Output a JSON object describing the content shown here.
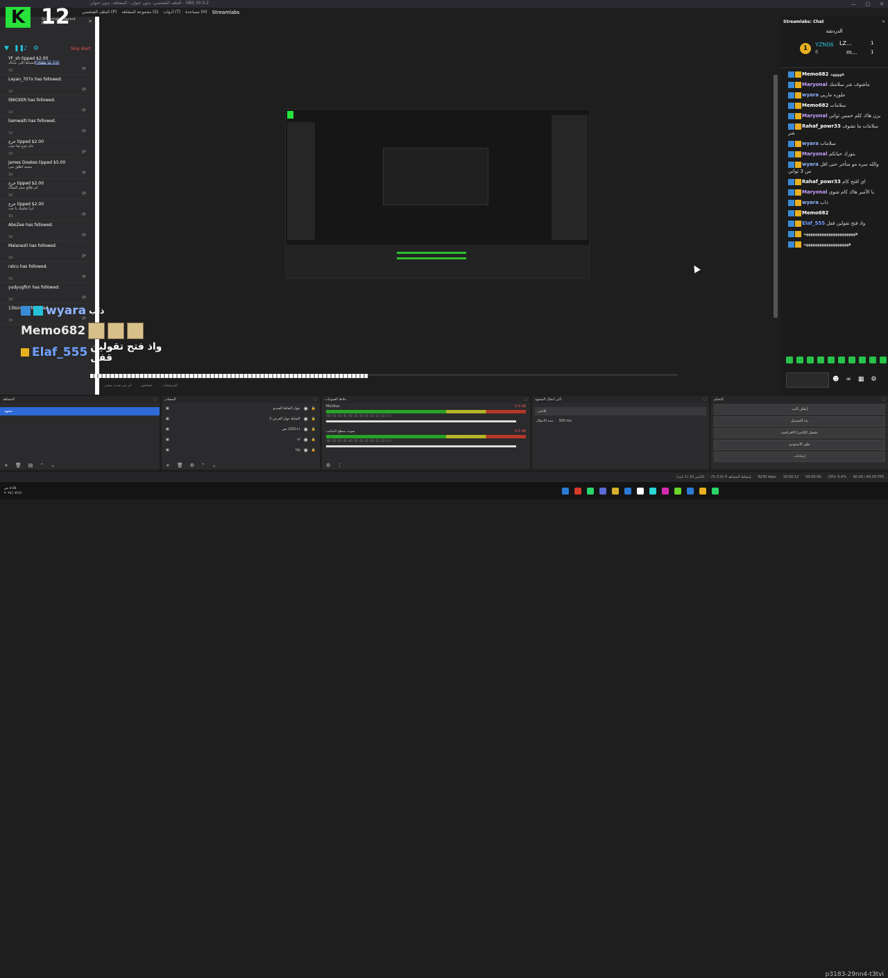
{
  "window": {
    "title": "الملف الشخصي: بدون عنوان - المشاهد: بدون عنوان - OBS 30.0.2",
    "min": "—",
    "max": "▢",
    "close": "✕"
  },
  "menu": [
    "الملف الشخصي (P)",
    "مجموعة المشاهد (S)",
    "أدوات (T)",
    "مساعدة (H)",
    "Streamlabs"
  ],
  "logo": {
    "k": "K",
    "n": "12"
  },
  "feed_header": "Streamlabs: Recent Events",
  "feed": {
    "skip": "Skip Alert",
    "jump": "Jump to top",
    "events": [
      {
        "name": "YF_sh tipped $2.00",
        "msg": "بزت مو معقول النشاط اللي عنداك",
        "time": "3d"
      },
      {
        "name": "Layan_707x has followed.",
        "msg": "",
        "time": "1d"
      },
      {
        "name": "SNICKER has followed.",
        "msg": "",
        "time": "1d"
      },
      {
        "name": "liamwalti has followed.",
        "msg": "",
        "time": "1d"
      },
      {
        "name": "حرح tipped $2.00",
        "msg": "عام حوج هنا حيب",
        "time": "3d"
      },
      {
        "name": "James Doakes tipped $5.00",
        "msg": "محمد اطلق منى",
        "time": "3d"
      },
      {
        "name": "حرح tipped $2.00",
        "msg": "كم طالع سعر الشالة",
        "time": "3d"
      },
      {
        "name": "حرح tipped $2.00",
        "msg": "ابرا شلونك يا حب",
        "time": "3d"
      },
      {
        "name": "AboZee has followed.",
        "msg": "",
        "time": "3d"
      },
      {
        "name": "Malanezli has followed.",
        "msg": "",
        "time": "3d"
      },
      {
        "name": "ralcu has followed.",
        "msg": "",
        "time": "3d"
      },
      {
        "name": "yudyugfirri has followed.",
        "msg": "",
        "time": "3d"
      },
      {
        "name": "13lsin has followed.",
        "msg": "",
        "time": "3d"
      }
    ]
  },
  "overlay": {
    "line1_user": "wyara",
    "line1_text": "ذاب",
    "line2_user": "Memo682",
    "line3_user": "Elaf_555",
    "line3_text": "واذ فتح تقولين قفل"
  },
  "preview_sources": [
    "لم يتم تحديد مصدر",
    "خصائص",
    "المرشحات"
  ],
  "chat": {
    "header": "Streamlabs: Chat",
    "title": "الدردشة",
    "leader": {
      "coin": "1",
      "u1": "YZN06",
      "u1b": "6",
      "u2": "LZ...",
      "u3": "m...",
      "c1": "1",
      "c2": "1"
    },
    "messages": [
      {
        "user": "Memo682",
        "color": "#ffffff",
        "text": "هههههه"
      },
      {
        "user": "Maryonal",
        "color": "#c8a0ff",
        "text": "ماشوف شر سلامتك"
      },
      {
        "user": "wyara",
        "color": "#8fb4ff",
        "text": "ملوره ماريي"
      },
      {
        "user": "Memo682",
        "color": "#ffffff",
        "text": "سلامات"
      },
      {
        "user": "Maryonal",
        "color": "#c8a0ff",
        "text": "يزن هاك كلم خمس ثواني"
      },
      {
        "user": "Rahaf_powr33",
        "color": "#ffffff",
        "text": "سلامات ما تشوف شر"
      },
      {
        "user": "wyara",
        "color": "#8fb4ff",
        "text": "سلامات"
      },
      {
        "user": "Maryonal",
        "color": "#c8a0ff",
        "text": "بتورك حياتكم"
      },
      {
        "user": "wyara",
        "color": "#8fb4ff",
        "text": "والله سره مو متأخر حتى اقل من 3 ثواني"
      },
      {
        "user": "Rahaf_powr33",
        "color": "#ffffff",
        "text": "اي افتح كام"
      },
      {
        "user": "Maryonal",
        "color": "#c8a0ff",
        "text": "يا الأمير هاك كام شوي"
      },
      {
        "user": "wyara",
        "color": "#8fb4ff",
        "text": "ذاب"
      },
      {
        "user": "Memo682",
        "color": "#ffffff",
        "text": ""
      },
      {
        "user": "Elaf_555",
        "color": "#6fa0ff",
        "text": "واذ فتح تقولين قفل"
      },
      {
        "user": "",
        "color": "#ffffff",
        "text": "هههههههههههههههههههههههه"
      },
      {
        "user": "",
        "color": "#ffffff",
        "text": "ههههههههههههههههههههه"
      }
    ]
  },
  "panels": {
    "scenes": {
      "title": "المشاهد",
      "selected": "مشهد"
    },
    "sources": {
      "title": "المصادر",
      "items": [
        "جهاز التقاط الفيديو",
        "التقاط جهاز العرض 2",
        "نص (GDI+)",
        "vi",
        "tip"
      ]
    },
    "mixer": {
      "title": "خلاط الصوتيات",
      "ch1": "Mic/Aux",
      "ch1db": "0.0 dB",
      "ch2": "صوت سطح المكتب",
      "ch2db": "0.0 dB",
      "ticks": "-60 -55 -50 -45 -40 -35 -30 -25 -20 -15 -10 -5 0"
    },
    "transitions": {
      "title": "تأثير انتقال المشهد",
      "sel": "تلاشي",
      "dur_label": "مدة الانتقال",
      "dur": "300 ms"
    },
    "controls": {
      "title": "التحكم",
      "buttons": [
        "إيقاف البث",
        "بدء التسجيل",
        "تشغيل الكاميرا الافتراضية",
        "طور الاستوديو",
        "إعدادات"
      ]
    }
  },
  "status": {
    "dropped": "إسقاط المشاهد 0 (0.0 %)",
    "kbps": "8230 kbps",
    "time": "10:00:12",
    "rec": "00:00:00",
    "cpu": "CPU: 0.4%",
    "fps": "60.00 / 60.00 FPS",
    "delay": "التأخير 10 (1 ثانية)"
  },
  "taskbar": {
    "clock": "٨:٥٥ ص",
    "date": "٢٠٢٤/٠٧/١٥",
    "watermark": "p3183-29nn4-t3tvi"
  }
}
